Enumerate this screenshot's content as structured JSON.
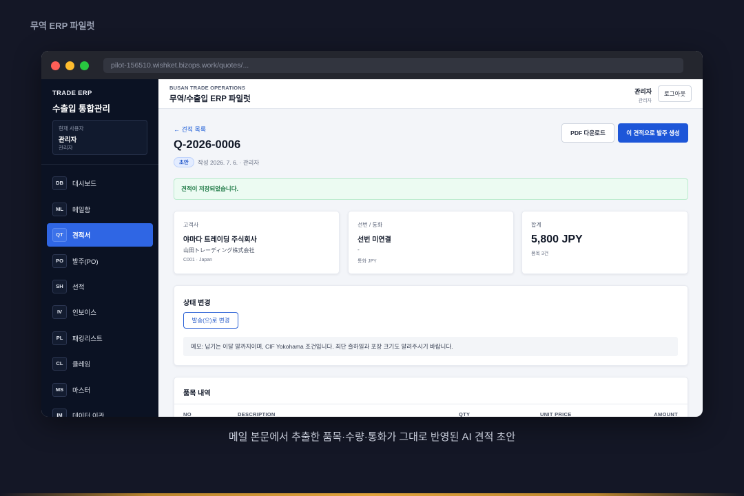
{
  "page": {
    "top_caption": "무역 ERP 파일럿",
    "bottom_caption": "메일 본문에서 추출한 품목·수량·통화가 그대로 반영된 AI 견적 초안"
  },
  "browser": {
    "url": "pilot-156510.wishket.bizops.work/quotes/..."
  },
  "sidebar": {
    "brand_small": "TRADE ERP",
    "brand_title": "수출입 통합관리",
    "user_card": {
      "label": "현재 사용자",
      "name": "관리자",
      "role": "관리자"
    },
    "items": [
      {
        "code": "DB",
        "label": "대시보드"
      },
      {
        "code": "ML",
        "label": "메일함"
      },
      {
        "code": "QT",
        "label": "견적서"
      },
      {
        "code": "PO",
        "label": "발주(PO)"
      },
      {
        "code": "SH",
        "label": "선적"
      },
      {
        "code": "IV",
        "label": "인보이스"
      },
      {
        "code": "PL",
        "label": "패킹리스트"
      },
      {
        "code": "CL",
        "label": "클레임"
      },
      {
        "code": "MS",
        "label": "마스터"
      },
      {
        "code": "IM",
        "label": "데이터 이관"
      }
    ],
    "active_item": "QT"
  },
  "header": {
    "small": "BUSAN TRADE OPERATIONS",
    "title": "무역/수출입 ERP 파일럿",
    "user_name": "관리자",
    "user_role": "관리자",
    "logout_label": "로그아웃"
  },
  "quote": {
    "back_label": "← 견적 목록",
    "id": "Q-2026-0006",
    "status": "초안",
    "meta": "작성 2026. 7. 6. · 관리자",
    "pdf_button": "PDF 다운로드",
    "po_button": "이 견적으로 발주 생성",
    "alert": "견적이 저장되었습니다."
  },
  "cards": {
    "customer": {
      "label": "고객사",
      "name": "야마다 트레이딩 주식회사",
      "name_local": "山田トレーディング株式会社",
      "code_country": "C001 · Japan"
    },
    "vessel": {
      "label": "선번 / 통화",
      "vessel": "선번 미연결",
      "dash": "-",
      "currency": "통화 JPY"
    },
    "total": {
      "label": "합계",
      "amount": "5,800 JPY",
      "count": "품목 3건"
    }
  },
  "status_change": {
    "title": "상태 변경",
    "button": "발송(으)로 변경",
    "memo": "메모: 납기는 이달 말까지이며, CIF Yokohama 조건입니다. 최단 출하일과 포장 크기도 알려주시기 바랍니다."
  },
  "items_table": {
    "title": "품목 내역",
    "columns": [
      "NO",
      "DESCRIPTION",
      "QTY",
      "UNIT PRICE",
      "AMOUNT"
    ]
  },
  "colors": {
    "accent": "#1d56d8",
    "sidebar_bg": "#0b1223",
    "active_nav": "#2f66e4",
    "success": "#1f7a46"
  }
}
